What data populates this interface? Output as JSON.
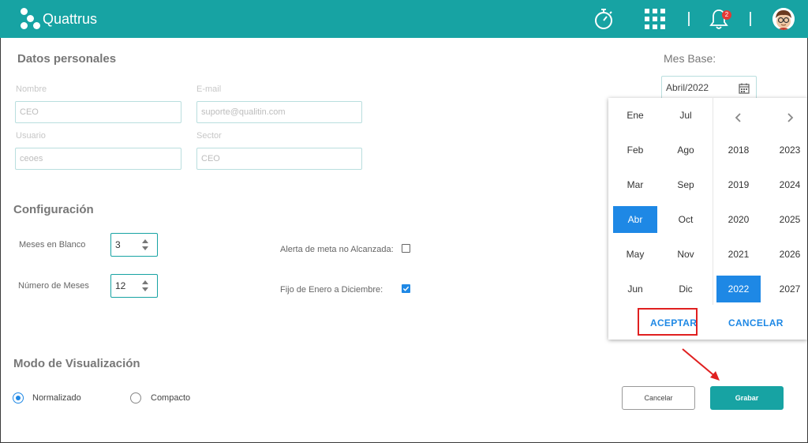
{
  "header": {
    "brand": "Quattrus",
    "notification_count": "2",
    "icons": [
      "stopwatch-icon",
      "apps-grid-icon",
      "bell-icon",
      "avatar"
    ]
  },
  "personal": {
    "title": "Datos personales",
    "nombre_label": "Nombre",
    "nombre_value": "CEO",
    "email_label": "E-mail",
    "email_value": "suporte@qualitin.com",
    "usuario_label": "Usuario",
    "usuario_value": "ceoes",
    "sector_label": "Sector",
    "sector_value": "CEO"
  },
  "config": {
    "title": "Configuración",
    "meses_blanco_label": "Meses en Blanco",
    "meses_blanco_value": "3",
    "numero_meses_label": "Número de Meses",
    "numero_meses_value": "12",
    "alerta_label": "Alerta de meta no Alcanzada:",
    "alerta_checked": false,
    "fijo_label": "Fijo de Enero a Diciembre:",
    "fijo_checked": true
  },
  "mes_base": {
    "title": "Mes Base:",
    "value": "Abril/2022",
    "months_col1": [
      "Ene",
      "Feb",
      "Mar",
      "Abr",
      "May",
      "Jun"
    ],
    "months_col2": [
      "Jul",
      "Ago",
      "Sep",
      "Oct",
      "Nov",
      "Dic"
    ],
    "selected_month": "Abr",
    "years_col1": [
      "2018",
      "2019",
      "2020",
      "2021",
      "2022"
    ],
    "years_col2": [
      "2023",
      "2024",
      "2025",
      "2026",
      "2027"
    ],
    "selected_year": "2022",
    "accept_label": "ACEPTAR",
    "cancel_label": "CANCELAR"
  },
  "visual": {
    "title": "Modo de Visualización",
    "option_normal": "Normalizado",
    "option_compact": "Compacto",
    "selected": "Normalizado"
  },
  "actions": {
    "cancel_label": "Cancelar",
    "save_label": "Grabar"
  },
  "colors": {
    "brand": "#17a3a3",
    "accent_blue": "#1e88e5",
    "annotation_red": "#e02020"
  }
}
